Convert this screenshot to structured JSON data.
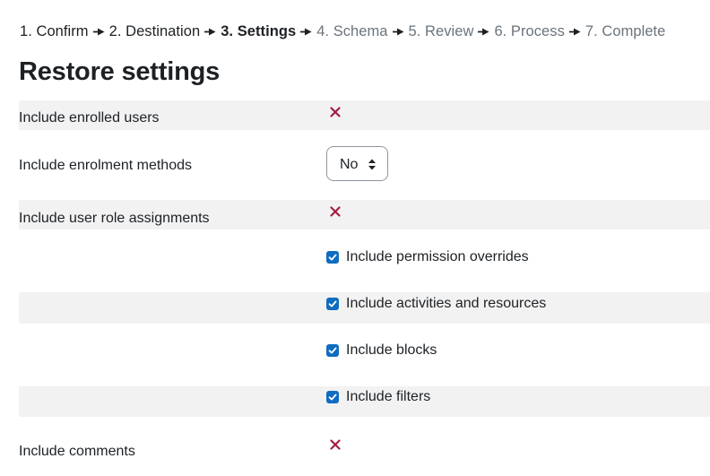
{
  "steps": [
    {
      "label": "1. Confirm",
      "state": "done"
    },
    {
      "label": "2. Destination",
      "state": "done"
    },
    {
      "label": "3. Settings",
      "state": "current"
    },
    {
      "label": "4. Schema",
      "state": "future"
    },
    {
      "label": "5. Review",
      "state": "future"
    },
    {
      "label": "6. Process",
      "state": "future"
    },
    {
      "label": "7. Complete",
      "state": "future"
    }
  ],
  "heading": "Restore settings",
  "settings": {
    "enrolled_users": {
      "label": "Include enrolled users",
      "state": "disabled"
    },
    "enrolment_methods": {
      "label": "Include enrolment methods",
      "selected": "No"
    },
    "role_assignments": {
      "label": "Include user role assignments",
      "state": "disabled"
    },
    "permission_overrides": {
      "label": "Include permission overrides",
      "checked": true
    },
    "activities": {
      "label": "Include activities and resources",
      "checked": true
    },
    "blocks": {
      "label": "Include blocks",
      "checked": true
    },
    "filters": {
      "label": "Include filters",
      "checked": true
    },
    "comments": {
      "label": "Include comments",
      "state": "disabled"
    }
  },
  "icons": {
    "disabled": "cross-icon",
    "separator": "flag-arrow-icon",
    "checkbox": "checkmark-icon",
    "select": "sort-arrows-icon"
  },
  "colors": {
    "accent": "#0f6cbf",
    "cross": "#a21f44",
    "muted_text": "#6a737b",
    "row_shade": "#f2f2f2"
  }
}
